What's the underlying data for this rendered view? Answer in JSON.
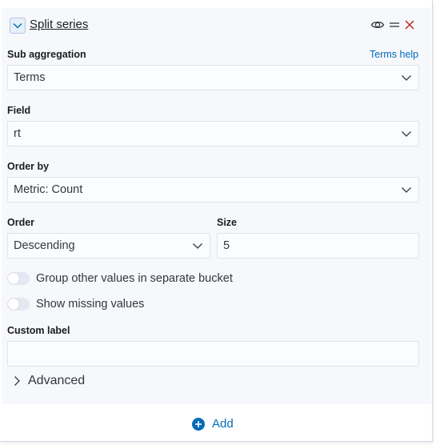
{
  "header": {
    "title": "Split series",
    "toggle_icon": "chevron-down-icon",
    "visibility_icon": "eye-icon",
    "drag_icon": "drag-handle-icon",
    "remove_icon": "close-icon"
  },
  "sub_aggregation": {
    "label": "Sub aggregation",
    "help": "Terms help",
    "value": "Terms"
  },
  "field": {
    "label": "Field",
    "value": "rt"
  },
  "order_by": {
    "label": "Order by",
    "value": "Metric: Count"
  },
  "order": {
    "label": "Order",
    "value": "Descending"
  },
  "size": {
    "label": "Size",
    "value": "5"
  },
  "switches": {
    "group_other": {
      "label": "Group other values in separate bucket",
      "on": false
    },
    "show_missing": {
      "label": "Show missing values",
      "on": false
    }
  },
  "custom_label": {
    "label": "Custom label",
    "value": ""
  },
  "advanced": {
    "label": "Advanced"
  },
  "add": {
    "label": "Add"
  },
  "colors": {
    "link": "#006bb8",
    "danger": "#bd271e",
    "panel_bg": "#f7f8fc"
  }
}
